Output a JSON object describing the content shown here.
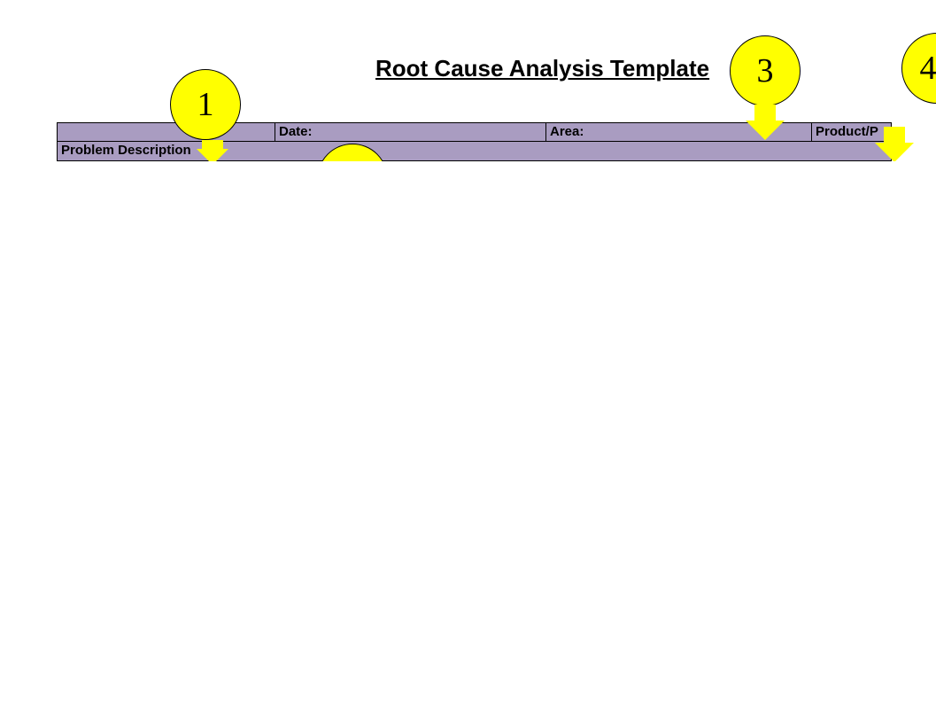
{
  "title": "Root Cause Analysis Template",
  "row1": {
    "col1": "",
    "col2": "Date:",
    "col3": "Area:",
    "col4": "Product/P"
  },
  "row2": {
    "label": "Problem Description"
  },
  "callouts": {
    "c1": "1",
    "c3": "3",
    "c4": "4"
  }
}
